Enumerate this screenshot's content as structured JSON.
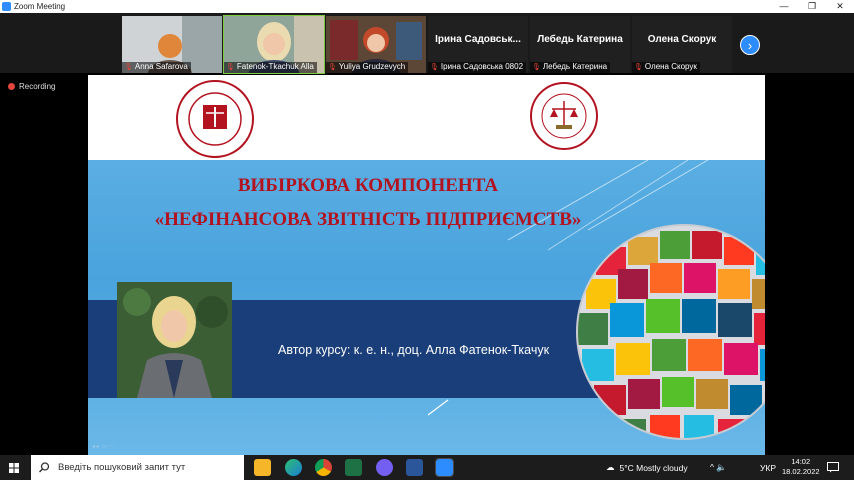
{
  "window": {
    "title": "Zoom Meeting",
    "controls": [
      "—",
      "❐",
      "✕"
    ]
  },
  "participants": [
    {
      "name": "Anna Safarova",
      "muted": true,
      "video": true
    },
    {
      "name": "Fatenok-Tkachuk Alla",
      "muted": true,
      "video": true,
      "active": true
    },
    {
      "name": "Yuliya Grudzevych",
      "muted": true,
      "video": true
    },
    {
      "name": "Ірина Садовська 0802",
      "display": "Ірина  Садовськ...",
      "muted": true,
      "video": false
    },
    {
      "name": "Лебедь Катерина",
      "display": "Лебедь Катерина",
      "muted": true,
      "video": false
    },
    {
      "name": "Олена Скорук",
      "display": "Олена Скорук",
      "muted": true,
      "video": false
    }
  ],
  "recording": {
    "label": "Recording"
  },
  "slide": {
    "title_line1": "ВИБІРКОВА КОМПОНЕНТА",
    "title_line2": "«НЕФІНАНСОВА ЗВІТНІСТЬ ПІДПРИЄМСТВ»",
    "author": "Автор курсу: к. е. н., доц. Алла Фатенок-Ткачук",
    "navigation": "◂  ▸  ▭  ⋯"
  },
  "taskbar": {
    "search_placeholder": "Введіть пошуковий запит тут",
    "weather": "5°C  Mostly cloudy",
    "language": "УКР",
    "time": "14:02",
    "date": "18.02.2022",
    "tray_icons": "^  🔈"
  },
  "colors": {
    "zoom_blue": "#2d8cff",
    "slide_title_red": "#b3121f",
    "band_navy": "#1a3e7a",
    "recording_red": "#e5453a"
  }
}
